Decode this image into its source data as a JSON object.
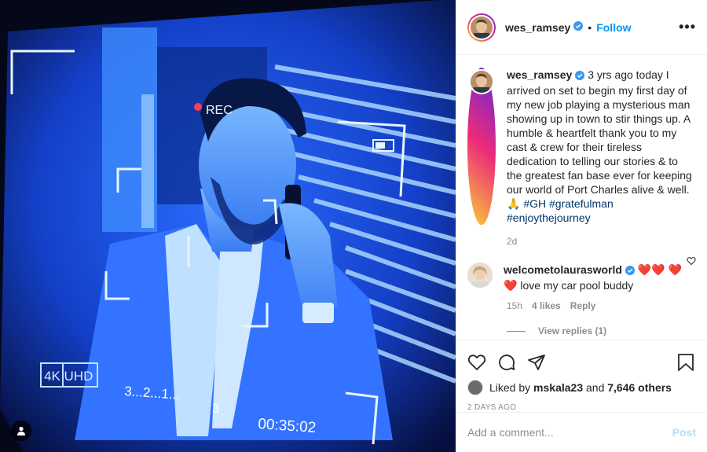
{
  "post": {
    "author": "wes_ramsey",
    "follow_label": "Follow",
    "dot": "•",
    "more_label": "•••",
    "caption": "3 yrs ago today I arrived on set to begin my first day of my new job playing a mysterious man showing up in town to stir things up. A humble & heartfelt thank you to my cast & crew for their tireless dedication to telling our stories & to the greatest fan base ever for keeping our world of Port Charles alive & well. 🙏",
    "hashtags": [
      "#GH",
      "#gratefulman",
      "#enjoythejourney"
    ],
    "caption_age": "2d"
  },
  "comment": {
    "author": "welcometolaurasworld",
    "emoji_lead": "❤️❤️",
    "emoji_tail": "❤️❤️",
    "text": "love my car pool buddy",
    "age": "15h",
    "likes": "4 likes",
    "reply_label": "Reply",
    "view_replies": "View replies (1)"
  },
  "engagement": {
    "liked_by_prefix": "Liked by",
    "liked_by_user": "mskala23",
    "and": "and",
    "others": "7,646 others",
    "date": "2 DAYS AGO"
  },
  "composer": {
    "placeholder": "Add a comment...",
    "post_label": "Post"
  },
  "photo": {
    "rec": "REC",
    "uhd": "4K UHD",
    "countdown": "3...2...1...",
    "countdown_tail": "3",
    "timecode": "00:35:02"
  },
  "colors": {
    "link_blue": "#0095f6",
    "hashtag_blue": "#00376b",
    "muted": "#8e8e8e",
    "heart_red": "#ed4956",
    "monitor_blue": "#1e64ff"
  },
  "icons": [
    "verified-badge-icon",
    "more-options-icon",
    "heart-icon",
    "comment-icon",
    "share-icon",
    "save-icon",
    "user-tag-icon"
  ]
}
